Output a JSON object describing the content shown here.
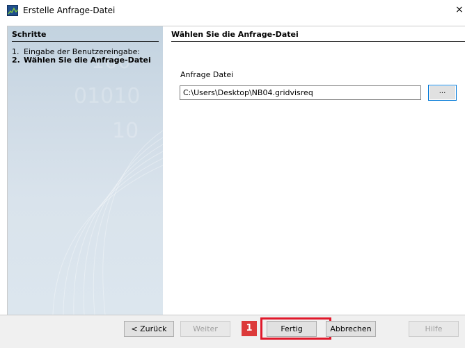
{
  "window": {
    "title": "Erstelle Anfrage-Datei",
    "close_glyph": "×"
  },
  "sidebar": {
    "title": "Schritte",
    "steps": [
      {
        "num": "1.",
        "label": "Eingabe der Benutzereingabe:"
      },
      {
        "num": "2.",
        "label": "Wählen Sie die Anfrage-Datei"
      }
    ]
  },
  "content": {
    "title": "Wählen Sie die Anfrage-Datei",
    "field_label": "Anfrage Datei",
    "file_value": "C:\\Users\\Desktop\\NB04.gridvisreq",
    "browse_label": "..."
  },
  "footer": {
    "back_label": "< Zurück",
    "next_label": "Weiter",
    "finish_label": "Fertig",
    "cancel_label": "Abbrechen",
    "help_label": "Hilfe",
    "step_badge": "1"
  },
  "colors": {
    "highlight": "#e0192b",
    "badge": "#dc3a3a",
    "focus": "#0078d7"
  },
  "icons": {
    "app": "app-icon",
    "close": "close-icon"
  }
}
